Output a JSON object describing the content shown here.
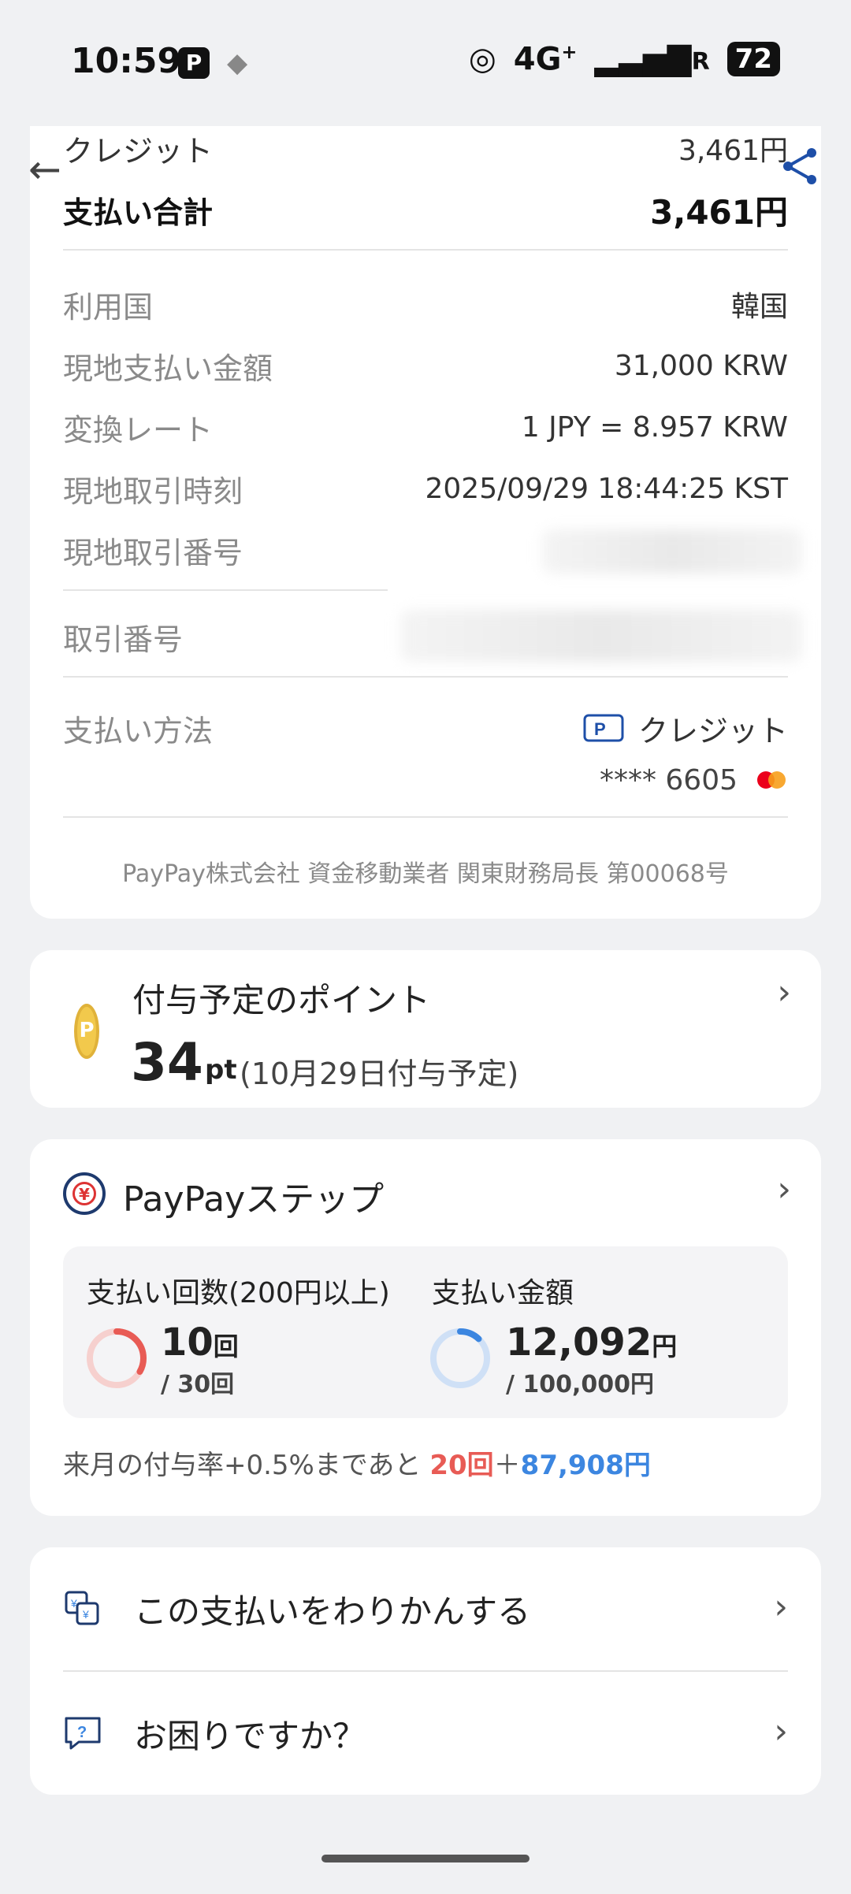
{
  "status_bar": {
    "time": "10:59",
    "network": "4G",
    "network_suffix": "+",
    "carrier_flag": "R",
    "battery": "72"
  },
  "payment_details": {
    "credit_label": "クレジット",
    "credit_amount": "3,461円",
    "total_label": "支払い合計",
    "total_amount": "3,461円",
    "rows": [
      {
        "label": "利用国",
        "value": "韓国"
      },
      {
        "label": "現地支払い金額",
        "value": "31,000 KRW"
      },
      {
        "label": "変換レート",
        "value": "1 JPY = 8.957 KRW"
      },
      {
        "label": "現地取引時刻",
        "value": "2025/09/29 18:44:25 KST"
      },
      {
        "label": "現地取引番号",
        "value": ""
      },
      {
        "label": "取引番号",
        "value": ""
      }
    ],
    "method_label": "支払い方法",
    "method_value": "クレジット",
    "card_number": "**** 6605",
    "footer": "PayPay株式会社 資金移動業者 関東財務局長 第00068号"
  },
  "points": {
    "title": "付与予定のポイント",
    "amount": "34",
    "unit": "pt",
    "date_note": "(10月29日付与予定)"
  },
  "paypay_step": {
    "title": "PayPayステップ",
    "count_label": "支払い回数(200円以上)",
    "count_value": "10",
    "count_unit": "回",
    "count_target": "/ 30回",
    "count_progress": 0.333,
    "amount_label": "支払い金額",
    "amount_value": "12,092",
    "amount_unit": "円",
    "amount_target": "/ 100,000円",
    "amount_progress": 0.121,
    "note_prefix": "来月の付与率+0.5%まであと ",
    "note_count": "20回",
    "note_plus": "＋",
    "note_amount": "87,908円",
    "colors": {
      "count": "#e85b55",
      "amount": "#3c86e0"
    }
  },
  "menu": [
    {
      "label": "この支払いをわりかんする",
      "icon": "split-bill-icon"
    },
    {
      "label": "お困りですか？",
      "icon": "help-chat-icon"
    }
  ]
}
